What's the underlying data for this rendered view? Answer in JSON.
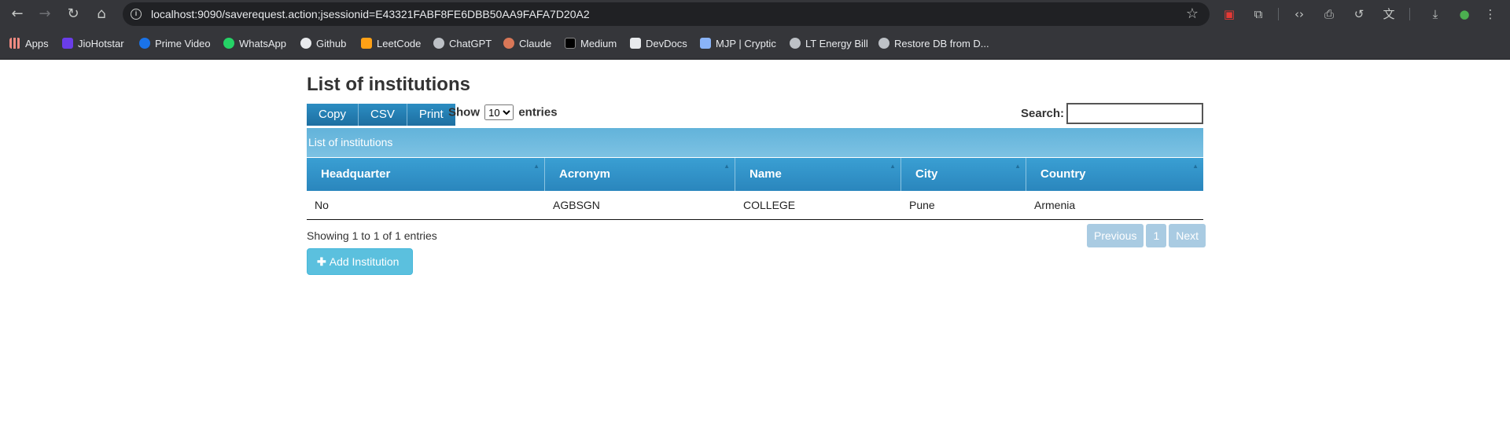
{
  "browser": {
    "url": "localhost:9090/saverequest.action;jsessionid=E43321FABF8FE6DBB50AA9FAFA7D20A2",
    "bookmarks": [
      {
        "label": "Apps",
        "icon": "apps-grid-icon"
      },
      {
        "label": "JioHotstar",
        "icon": "jiohotstar-icon"
      },
      {
        "label": "Prime Video",
        "icon": "prime-video-icon"
      },
      {
        "label": "WhatsApp",
        "icon": "whatsapp-icon"
      },
      {
        "label": "Github",
        "icon": "github-icon"
      },
      {
        "label": "LeetCode",
        "icon": "leetcode-icon"
      },
      {
        "label": "ChatGPT",
        "icon": "chatgpt-icon"
      },
      {
        "label": "Claude",
        "icon": "claude-icon"
      },
      {
        "label": "Medium",
        "icon": "medium-icon"
      },
      {
        "label": "DevDocs",
        "icon": "devdocs-icon"
      },
      {
        "label": "MJP | Cryptic",
        "icon": "mjp-icon"
      },
      {
        "label": "LT Energy Bill",
        "icon": "lt-energy-icon"
      },
      {
        "label": "Restore DB from D...",
        "icon": "restore-db-icon"
      }
    ]
  },
  "page": {
    "title": "List of institutions",
    "buttons": {
      "copy": "Copy",
      "csv": "CSV",
      "print": "Print"
    },
    "length": {
      "show": "Show",
      "value": "10",
      "entries": "entries"
    },
    "search_label": "Search:",
    "caption": "List of institutions",
    "columns": [
      "Headquarter",
      "Acronym",
      "Name",
      "City",
      "Country"
    ],
    "rows": [
      [
        "No",
        "AGBSGN",
        "COLLEGE",
        "Pune",
        "Armenia"
      ]
    ],
    "info": "Showing 1 to 1 of 1 entries",
    "pager": {
      "previous": "Previous",
      "page": "1",
      "next": "Next"
    },
    "add_button": "Add Institution"
  }
}
